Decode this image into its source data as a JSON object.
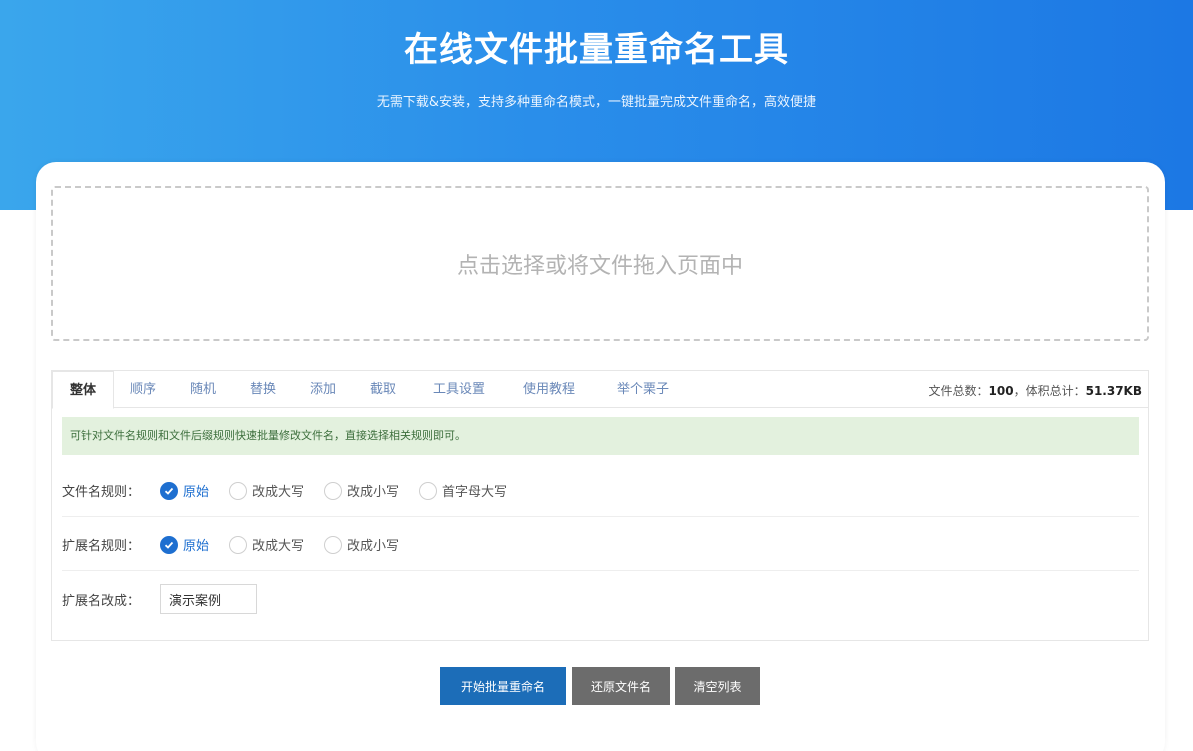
{
  "hero": {
    "title": "在线文件批量重命名工具",
    "subtitle": "无需下载&安装，支持多种重命名模式，一键批量完成文件重命名，高效便捷"
  },
  "dropzone": {
    "text": "点击选择或将文件拖入页面中"
  },
  "tabs": [
    {
      "label": "整体",
      "active": true
    },
    {
      "label": "顺序"
    },
    {
      "label": "随机"
    },
    {
      "label": "替换"
    },
    {
      "label": "添加"
    },
    {
      "label": "截取"
    },
    {
      "label": "工具设置"
    },
    {
      "label": "使用教程"
    },
    {
      "label": "举个栗子"
    }
  ],
  "stats": {
    "total_label": "文件总数：",
    "total_value": "100",
    "sep": "，",
    "size_label": "体积总计：",
    "size_value": "51.37KB"
  },
  "notice": "可针对文件名规则和文件后缀规则快速批量修改文件名，直接选择相关规则即可。",
  "filename_rule": {
    "label": "文件名规则：",
    "options": [
      "原始",
      "改成大写",
      "改成小写",
      "首字母大写"
    ],
    "selected": "原始"
  },
  "ext_rule": {
    "label": "扩展名规则：",
    "options": [
      "原始",
      "改成大写",
      "改成小写"
    ],
    "selected": "原始"
  },
  "ext_change": {
    "label": "扩展名改成：",
    "value": "演示案例"
  },
  "buttons": {
    "start": "开始批量重命名",
    "restore": "还原文件名",
    "clear": "清空列表"
  },
  "colors": {
    "accent": "#1e6fd0",
    "hero_start": "#3aa6ec",
    "hero_end": "#1c78e4",
    "notice_bg": "#e3f1de",
    "button_gray": "#6c6c6c"
  }
}
